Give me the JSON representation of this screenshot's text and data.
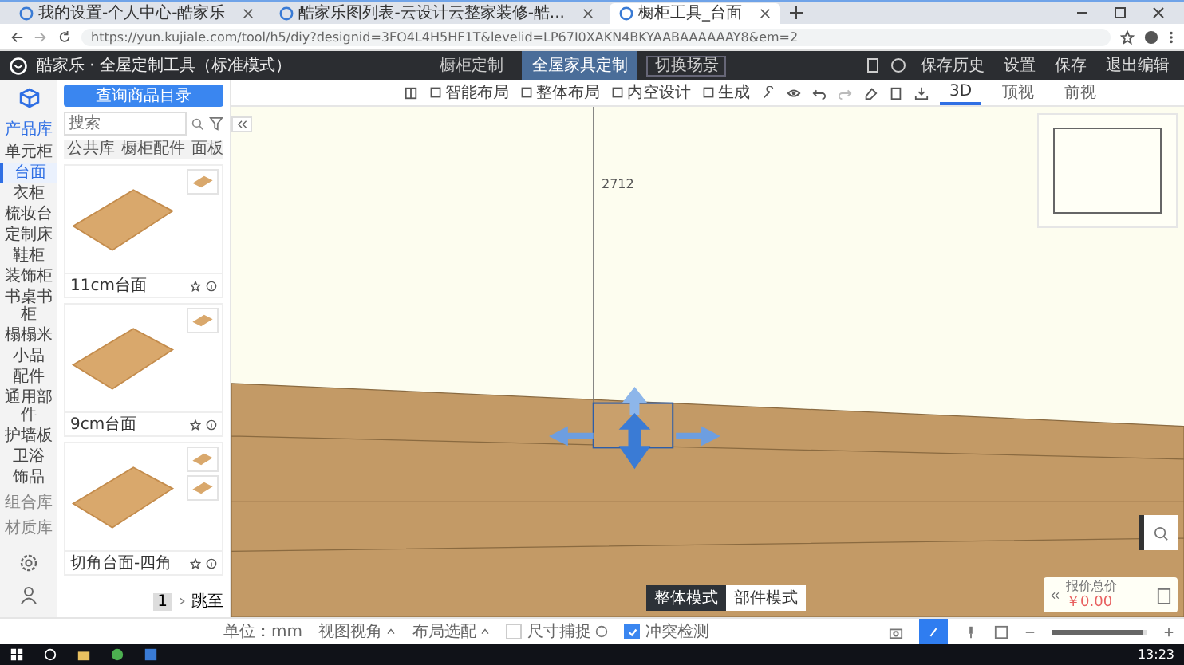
{
  "browser": {
    "tabs": [
      {
        "title": "我的设置-个人中心-酷家乐",
        "selected": false
      },
      {
        "title": "酷家乐图列表-云设计云整家装修-酷...",
        "selected": false
      },
      {
        "title": "橱柜工具_台面",
        "selected": true
      }
    ],
    "url": "https://yun.kujiale.com/tool/h5/diy?designid=3FO4L4H5HF1T&levelid=LP67I0XAKN4BKYAABAAAAAAY8&em=2"
  },
  "app": {
    "title": "酷家乐 · 全屋定制工具（标准模式）",
    "mode_tabs": [
      {
        "label": "橱柜定制",
        "selected": false
      },
      {
        "label": "全屋家具定制",
        "selected": true
      }
    ],
    "switch_scene": "切换场景",
    "actions": [
      "保存历史",
      "设置",
      "保存",
      "退出编辑"
    ],
    "toolbar": [
      "智能布局",
      "整体布局",
      "内空设计",
      "生成"
    ],
    "view_tabs": [
      {
        "label": "3D",
        "selected": true
      },
      {
        "label": "顶视",
        "selected": false
      },
      {
        "label": "前视",
        "selected": false
      }
    ]
  },
  "sidebar": {
    "header": "产品库",
    "categories": [
      {
        "label": "单元柜",
        "selected": false
      },
      {
        "label": "台面",
        "selected": true
      },
      {
        "label": "衣柜",
        "selected": false
      },
      {
        "label": "梳妆台",
        "selected": false
      },
      {
        "label": "定制床",
        "selected": false
      },
      {
        "label": "鞋柜",
        "selected": false
      },
      {
        "label": "装饰柜",
        "selected": false
      },
      {
        "label": "书桌书柜",
        "selected": false
      },
      {
        "label": "榻榻米",
        "selected": false
      },
      {
        "label": "小品",
        "selected": false
      },
      {
        "label": "配件",
        "selected": false
      },
      {
        "label": "通用部件",
        "selected": false
      },
      {
        "label": "护墙板",
        "selected": false
      },
      {
        "label": "卫浴",
        "selected": false
      },
      {
        "label": "饰品",
        "selected": false
      }
    ],
    "groups": [
      "组合库",
      "材质库"
    ]
  },
  "panel": {
    "catalog_button": "查询商品目录",
    "search": {
      "placeholder": "搜索"
    },
    "breadcrumb": [
      "公共库",
      "橱柜配件",
      "面板"
    ],
    "products": [
      {
        "name": "11cm台面"
      },
      {
        "name": "9cm台面"
      },
      {
        "name": "切角台面-四角"
      }
    ],
    "page": "1",
    "jump": "跳至"
  },
  "canvas": {
    "dimension": "2712",
    "mode_toggle": [
      {
        "label": "整体模式",
        "selected": true
      },
      {
        "label": "部件模式",
        "selected": false
      }
    ],
    "price": {
      "label": "报价总价",
      "value": "￥0.00"
    }
  },
  "status_bar": {
    "unit": "单位：mm",
    "items": [
      {
        "kind": "dropdown",
        "label": "视图视角"
      },
      {
        "kind": "dropdown",
        "label": "布局选配"
      },
      {
        "kind": "checkbox",
        "label": "尺寸捕捉",
        "checked": false
      },
      {
        "kind": "checkbox",
        "label": "冲突检测",
        "checked": true
      }
    ],
    "zoom": {
      "level": 0.95
    }
  },
  "taskbar": {
    "time": "13:23"
  }
}
